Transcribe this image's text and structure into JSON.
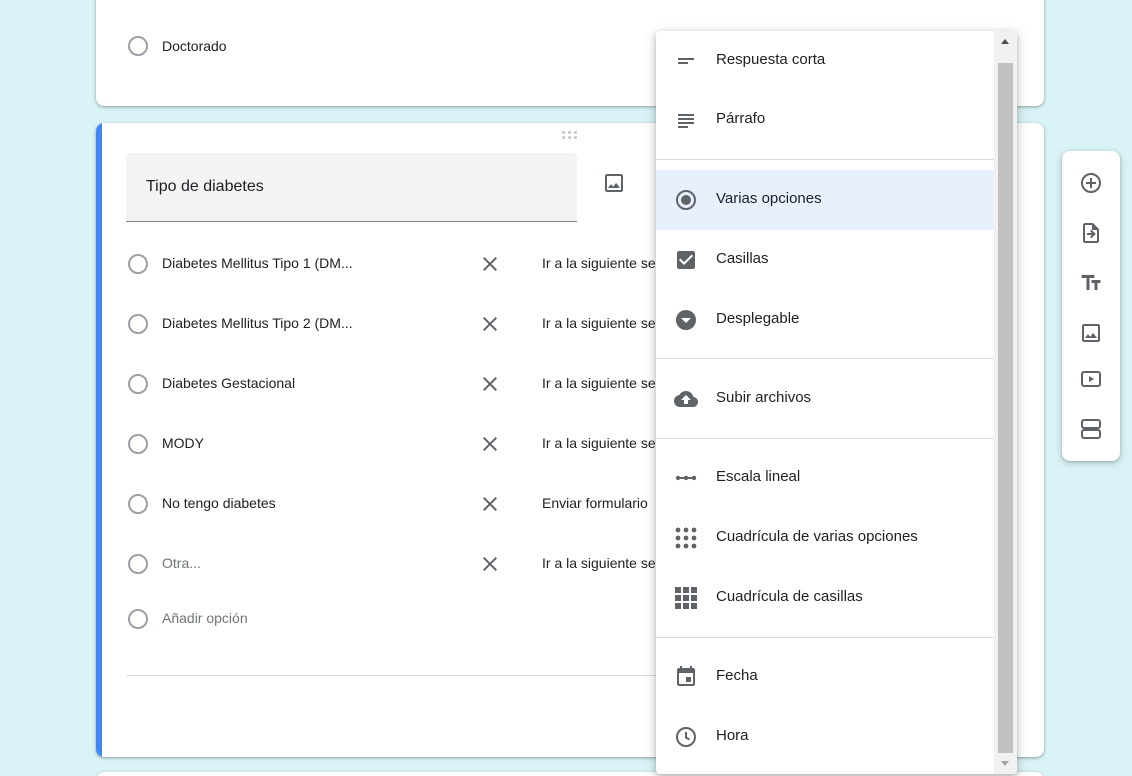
{
  "previous_question": {
    "last_option": "Doctorado"
  },
  "question": {
    "title": "Tipo de diabetes",
    "options": [
      {
        "label": "Diabetes Mellitus Tipo 1 (DM...",
        "goto": "Ir a la siguiente sección"
      },
      {
        "label": "Diabetes Mellitus Tipo 2 (DM...",
        "goto": "Ir a la siguiente sección"
      },
      {
        "label": "Diabetes Gestacional",
        "goto": "Ir a la siguiente sección"
      },
      {
        "label": "MODY",
        "goto": "Ir a la siguiente sección"
      },
      {
        "label": "No tengo diabetes",
        "goto": "Enviar formulario"
      },
      {
        "label": "Otra...",
        "goto": "Ir a la siguiente sección"
      }
    ],
    "add_option_label": "Añadir opción"
  },
  "type_menu": {
    "items": [
      {
        "label": "Respuesta corta",
        "icon": "short-answer-icon"
      },
      {
        "label": "Párrafo",
        "icon": "paragraph-icon"
      },
      {
        "label": "Varias opciones",
        "icon": "radio-icon",
        "selected": true
      },
      {
        "label": "Casillas",
        "icon": "checkbox-icon"
      },
      {
        "label": "Desplegable",
        "icon": "dropdown-icon"
      },
      {
        "label": "Subir archivos",
        "icon": "cloud-upload-icon"
      },
      {
        "label": "Escala lineal",
        "icon": "linear-scale-icon"
      },
      {
        "label": "Cuadrícula de varias opciones",
        "icon": "multiple-choice-grid-icon"
      },
      {
        "label": "Cuadrícula de casillas",
        "icon": "checkbox-grid-icon"
      },
      {
        "label": "Fecha",
        "icon": "calendar-icon"
      },
      {
        "label": "Hora",
        "icon": "clock-icon"
      }
    ]
  },
  "toolbar": {
    "buttons": [
      "add-question-icon",
      "import-questions-icon",
      "add-title-icon",
      "add-image-icon",
      "add-video-icon",
      "add-section-icon"
    ]
  },
  "colors": {
    "accent": "#4285f4",
    "background": "#d9f3f7",
    "selected_bg": "#e8f0fe"
  }
}
